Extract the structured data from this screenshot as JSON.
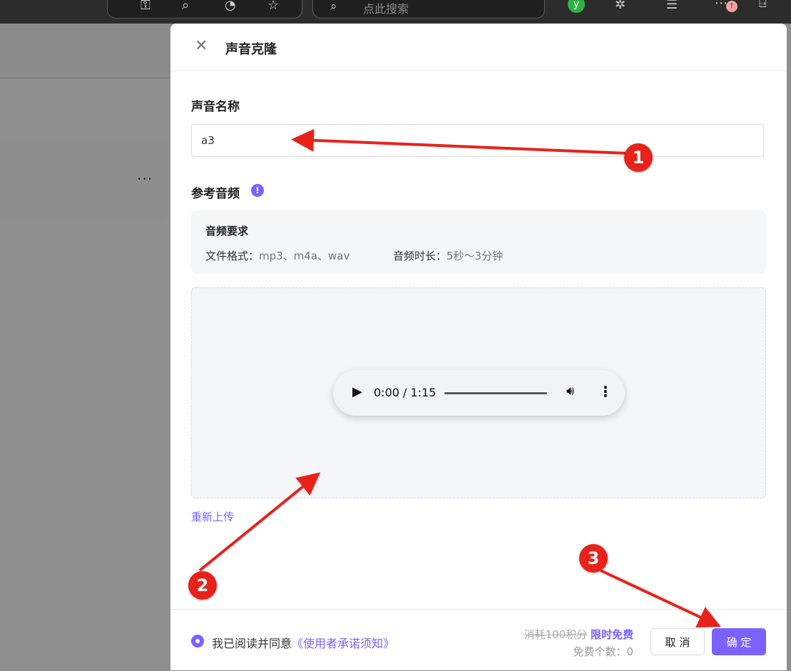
{
  "browser": {
    "search_placeholder": "点此搜索"
  },
  "background": {
    "card_more": "···"
  },
  "drawer": {
    "title": "声音克隆",
    "close_icon": "✕",
    "name_label": "声音名称",
    "name_value": "a3",
    "ref_audio_label": "参考音频",
    "info_icon": "!",
    "requirements": {
      "title": "音频要求",
      "format_label": "文件格式：",
      "format_value": "mp3、m4a、wav",
      "duration_label": "音频时长：",
      "duration_value": "5秒～3分钟"
    },
    "player": {
      "time": "0:00 / 1:15",
      "progress": 0
    },
    "reupload": "重新上传",
    "footer": {
      "agree_text": "我已阅读并同意",
      "agree_link": "《使用者承诺须知》",
      "cost_old": "消耗100积分",
      "cost_free": "限时免费",
      "free_count": "免费个数：0",
      "cancel": "取 消",
      "confirm": "确 定"
    }
  },
  "annotations": {
    "steps": [
      "1",
      "2",
      "3"
    ],
    "color": "#e8221b"
  },
  "colors": {
    "accent": "#7b61ff",
    "overlay": "#8f8f8f"
  }
}
